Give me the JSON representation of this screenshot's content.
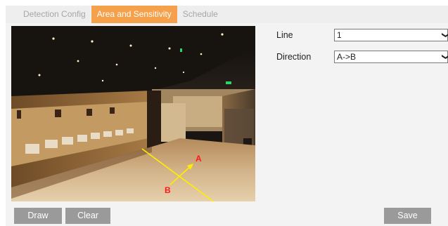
{
  "tabs": [
    {
      "label": "Detection Config",
      "active": false
    },
    {
      "label": "Area and Sensitivity",
      "active": true
    },
    {
      "label": "Schedule",
      "active": false
    }
  ],
  "form": {
    "line_label": "Line",
    "line_value": "1",
    "direction_label": "Direction",
    "direction_value": "A->B"
  },
  "overlay": {
    "point_a": "A",
    "point_b": "B"
  },
  "buttons": {
    "draw": "Draw",
    "clear": "Clear",
    "save": "Save"
  },
  "colors": {
    "active_tab": "#f5a04a",
    "button": "#9a9a9a",
    "line": "#ffee00",
    "marker_text": "#ff1a1a"
  }
}
